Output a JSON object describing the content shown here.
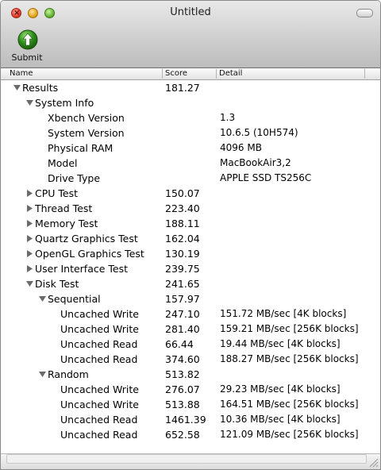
{
  "window": {
    "title": "Untitled"
  },
  "toolbar": {
    "submit_label": "Submit"
  },
  "columns": {
    "name": "Name",
    "score": "Score",
    "detail": "Detail"
  },
  "rows": [
    {
      "name": "Results",
      "score": "181.27",
      "detail": "",
      "level": 0,
      "disclosure": "open"
    },
    {
      "name": "System Info",
      "score": "",
      "detail": "",
      "level": 1,
      "disclosure": "open"
    },
    {
      "name": "Xbench Version",
      "score": "",
      "detail": "1.3",
      "level": 2,
      "disclosure": "none"
    },
    {
      "name": "System Version",
      "score": "",
      "detail": "10.6.5 (10H574)",
      "level": 2,
      "disclosure": "none"
    },
    {
      "name": "Physical RAM",
      "score": "",
      "detail": "4096 MB",
      "level": 2,
      "disclosure": "none"
    },
    {
      "name": "Model",
      "score": "",
      "detail": "MacBookAir3,2",
      "level": 2,
      "disclosure": "none"
    },
    {
      "name": "Drive Type",
      "score": "",
      "detail": "APPLE SSD TS256C",
      "level": 2,
      "disclosure": "none"
    },
    {
      "name": "CPU Test",
      "score": "150.07",
      "detail": "",
      "level": 1,
      "disclosure": "closed"
    },
    {
      "name": "Thread Test",
      "score": "223.40",
      "detail": "",
      "level": 1,
      "disclosure": "closed"
    },
    {
      "name": "Memory Test",
      "score": "188.11",
      "detail": "",
      "level": 1,
      "disclosure": "closed"
    },
    {
      "name": "Quartz Graphics Test",
      "score": "162.04",
      "detail": "",
      "level": 1,
      "disclosure": "closed"
    },
    {
      "name": "OpenGL Graphics Test",
      "score": "130.19",
      "detail": "",
      "level": 1,
      "disclosure": "closed"
    },
    {
      "name": "User Interface Test",
      "score": "239.75",
      "detail": "",
      "level": 1,
      "disclosure": "closed"
    },
    {
      "name": "Disk Test",
      "score": "241.65",
      "detail": "",
      "level": 1,
      "disclosure": "open"
    },
    {
      "name": "Sequential",
      "score": "157.97",
      "detail": "",
      "level": 2,
      "disclosure": "open"
    },
    {
      "name": "Uncached Write",
      "score": "247.10",
      "detail": "151.72 MB/sec [4K blocks]",
      "level": 3,
      "disclosure": "none"
    },
    {
      "name": "Uncached Write",
      "score": "281.40",
      "detail": "159.21 MB/sec [256K blocks]",
      "level": 3,
      "disclosure": "none"
    },
    {
      "name": "Uncached Read",
      "score": "66.44",
      "detail": "19.44 MB/sec [4K blocks]",
      "level": 3,
      "disclosure": "none"
    },
    {
      "name": "Uncached Read",
      "score": "374.60",
      "detail": "188.27 MB/sec [256K blocks]",
      "level": 3,
      "disclosure": "none"
    },
    {
      "name": "Random",
      "score": "513.82",
      "detail": "",
      "level": 2,
      "disclosure": "open"
    },
    {
      "name": "Uncached Write",
      "score": "276.07",
      "detail": "29.23 MB/sec [4K blocks]",
      "level": 3,
      "disclosure": "none"
    },
    {
      "name": "Uncached Write",
      "score": "513.88",
      "detail": "164.51 MB/sec [256K blocks]",
      "level": 3,
      "disclosure": "none"
    },
    {
      "name": "Uncached Read",
      "score": "1461.39",
      "detail": "10.36 MB/sec [4K blocks]",
      "level": 3,
      "disclosure": "none"
    },
    {
      "name": "Uncached Read",
      "score": "652.58",
      "detail": "121.09 MB/sec [256K blocks]",
      "level": 3,
      "disclosure": "none"
    }
  ],
  "icons": {
    "close": "close-icon",
    "minimize": "minimize-icon",
    "zoom": "zoom-icon",
    "submit": "submit-arrow-icon",
    "toolbar_toggle": "toolbar-toggle-icon",
    "resize": "resize-grip-icon"
  },
  "colors": {
    "submit_icon": "#2f8f1a",
    "close": "#d8301e",
    "minimize": "#dc9a10",
    "zoom": "#5aa827"
  }
}
